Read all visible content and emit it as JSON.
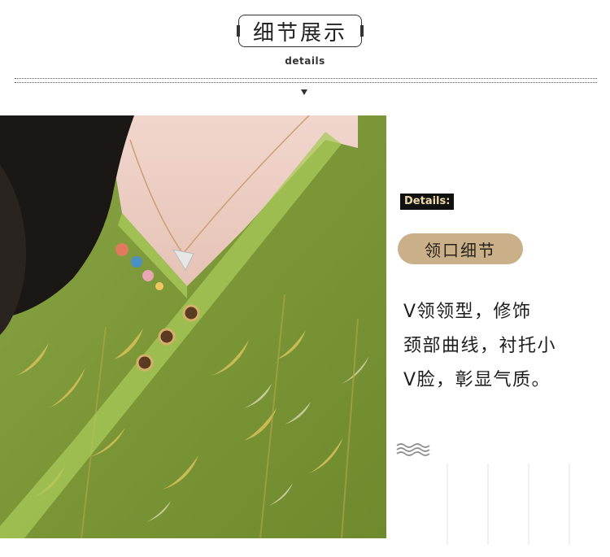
{
  "header": {
    "title": "细节展示",
    "subtitle": "details"
  },
  "photo": {
    "alt": ""
  },
  "panel": {
    "tag": "Details:",
    "section_title": "领口细节",
    "description_lines": [
      "V领领型，修饰",
      "颈部曲线，衬托小",
      "V脸，彰显气质。"
    ]
  },
  "colors": {
    "pill": "#c9b089",
    "tag_bg": "#111111",
    "tag_text": "#f0d9a8",
    "fabric_green": "#7f9a3a",
    "trim_green": "#a9c95a"
  },
  "icons": {
    "divider_arrow": "down-triangle-icon",
    "wave": "wave-icon"
  }
}
